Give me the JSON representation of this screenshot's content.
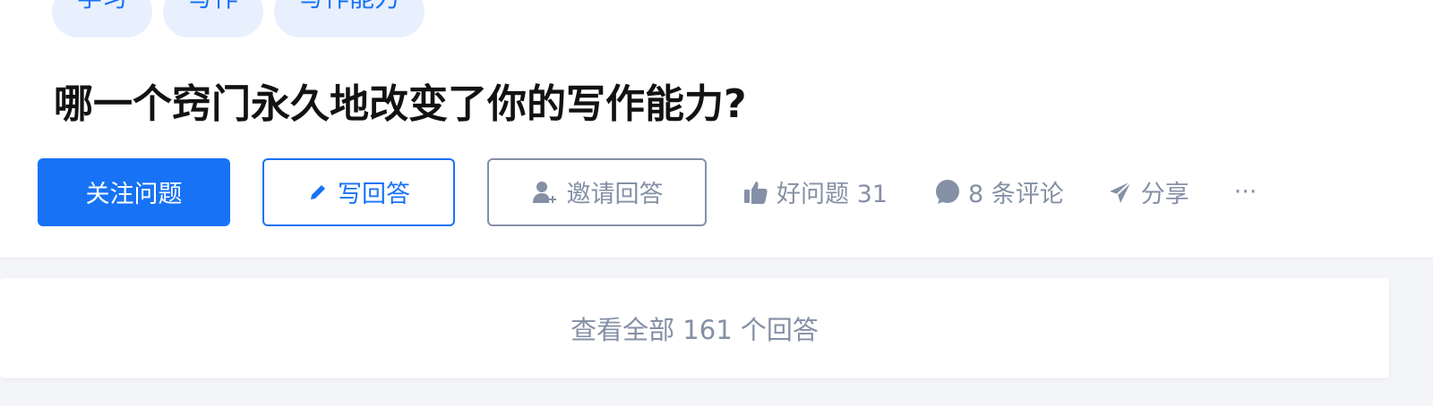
{
  "topics": [
    "学习",
    "写作",
    "写作能力"
  ],
  "question": {
    "title": "哪一个窍门永久地改变了你的写作能力?"
  },
  "actions": {
    "follow_label": "关注问题",
    "write_label": "写回答",
    "invite_label": "邀请回答",
    "good_question_label": "好问题 31",
    "comments_label": "8 条评论",
    "share_label": "分享",
    "more_label": "···"
  },
  "view_all_label": "查看全部 161 个回答",
  "icons": {
    "write": "pencil-icon",
    "invite": "invite-user-icon",
    "good_question": "thumbs-up-icon",
    "comments": "comment-bubble-icon",
    "share": "paper-plane-icon"
  },
  "colors": {
    "brand": "#1772f6",
    "muted": "#8590a6",
    "title": "#121212",
    "tag_bg": "#e8f0fd",
    "page_bg": "#f4f5f8"
  }
}
